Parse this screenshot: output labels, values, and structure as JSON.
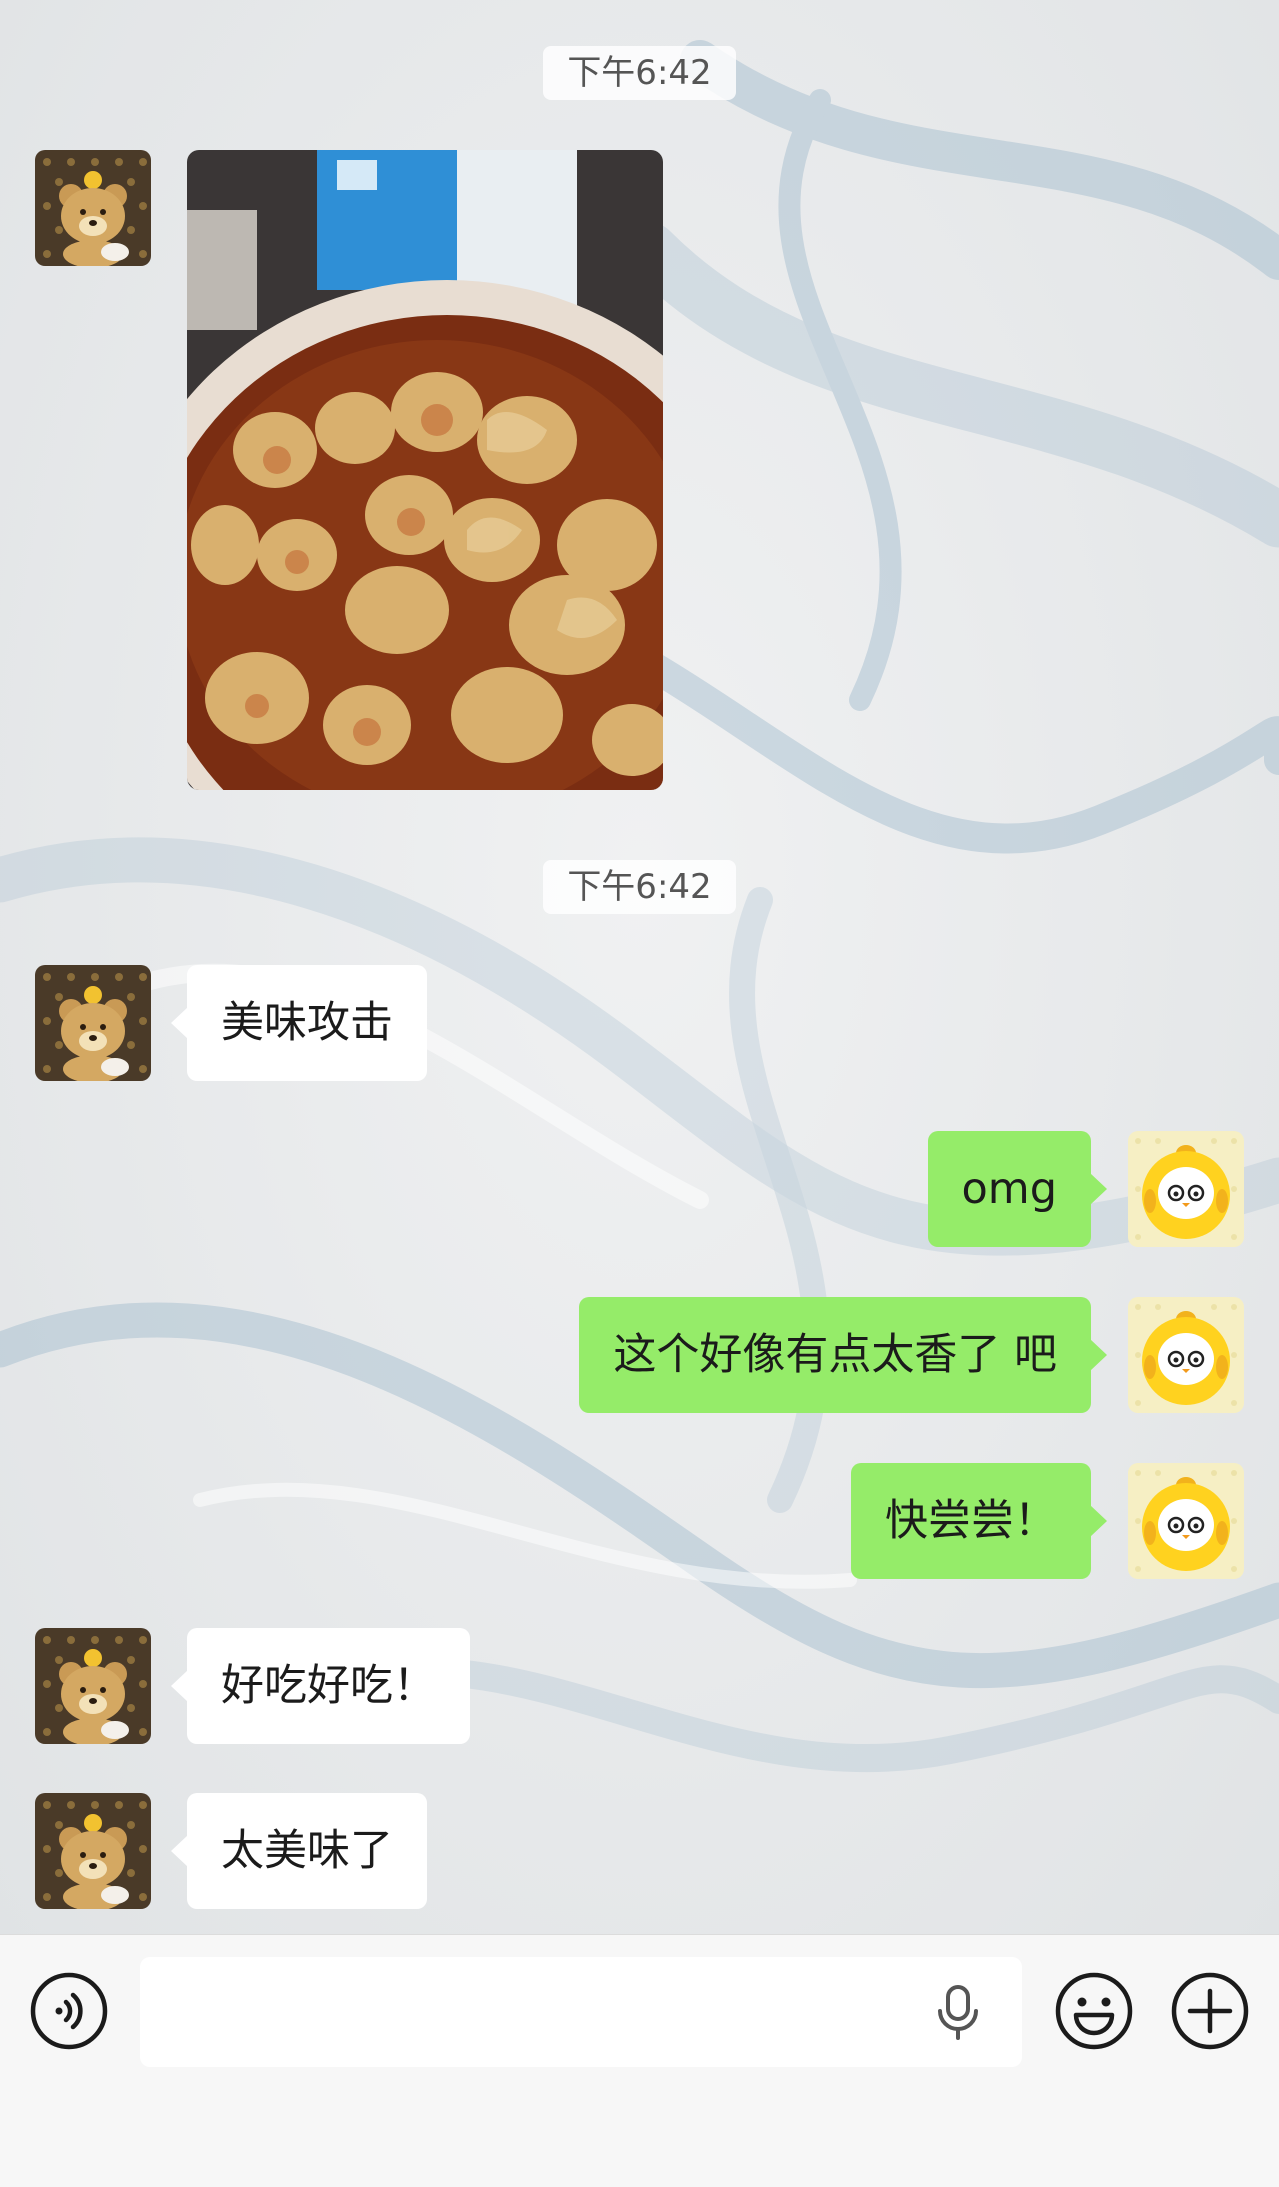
{
  "conversation": {
    "timestamps": [
      "下午6:42",
      "下午6:42"
    ],
    "messages": [
      {
        "sender": "contact",
        "type": "image",
        "content": "dumplings-in-chili-oil-photo"
      },
      {
        "sender": "contact",
        "type": "text",
        "text": "美味攻击"
      },
      {
        "sender": "me",
        "type": "text",
        "text": "omg"
      },
      {
        "sender": "me",
        "type": "text",
        "text": "这个好像有点太香了 吧"
      },
      {
        "sender": "me",
        "type": "text",
        "text": "快尝尝！"
      },
      {
        "sender": "contact",
        "type": "text",
        "text": "好吃好吃！"
      },
      {
        "sender": "contact",
        "type": "text",
        "text": "太美味了"
      }
    ]
  },
  "input_bar": {
    "placeholder": "",
    "icons": [
      "voice-mode-icon",
      "microphone-icon",
      "emoji-icon",
      "add-icon"
    ]
  },
  "colors": {
    "sent_bubble": "#95ec69",
    "received_bubble": "#ffffff",
    "background": "#e8eaec",
    "input_bar": "#f7f7f7"
  }
}
